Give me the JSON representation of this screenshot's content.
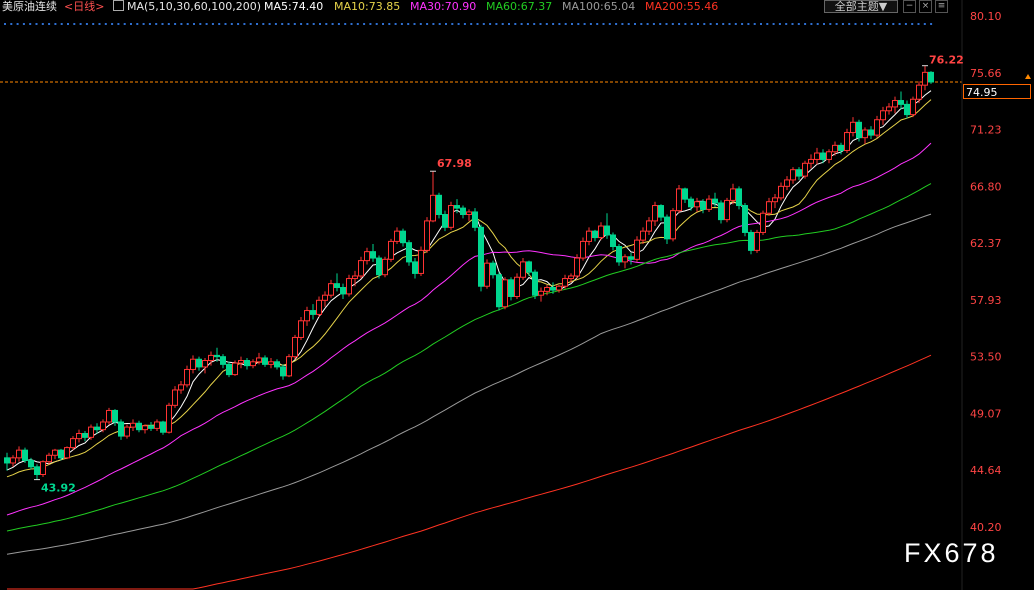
{
  "header": {
    "symbol": "美原油连续",
    "period": "<日线>",
    "ma_label": "MA(5,10,30,60,100,200)",
    "ma5": "MA5:74.40",
    "ma10": "MA10:73.85",
    "ma30": "MA30:70.90",
    "ma60": "MA60:67.37",
    "ma100": "MA100:65.04",
    "ma200": "MA200:55.46",
    "theme_button": "全部主题▼"
  },
  "colors": {
    "up": "#ff3333",
    "down": "#00d68f",
    "ma5": "#ffffff",
    "ma10": "#e6d34a",
    "ma30": "#ff33ff",
    "ma60": "#22cc22",
    "ma100": "#9a9a9a",
    "ma200": "#ff3322",
    "axis_text": "#ff4444",
    "current_price_line": "#ff8800"
  },
  "watermark": "FX678",
  "current_price": "74.95",
  "chart_data": {
    "type": "candlestick",
    "y_ticks": [
      "80.10",
      "75.66",
      "71.23",
      "66.80",
      "62.37",
      "57.93",
      "53.50",
      "49.07",
      "44.64",
      "40.20"
    ],
    "ylim": [
      37.8,
      80.1
    ],
    "grid": false,
    "annotations": {
      "high": "76.22",
      "peak_mid": "67.98",
      "low": "43.92"
    },
    "candles": [
      [
        45.6,
        46.0,
        44.6,
        45.2
      ],
      [
        45.2,
        45.8,
        44.9,
        45.6
      ],
      [
        45.6,
        46.5,
        45.3,
        46.2
      ],
      [
        46.2,
        46.4,
        45.2,
        45.4
      ],
      [
        45.4,
        45.6,
        44.7,
        44.9
      ],
      [
        44.9,
        45.1,
        43.9,
        44.3
      ],
      [
        44.3,
        45.4,
        44.1,
        45.3
      ],
      [
        45.3,
        46.0,
        45.1,
        45.8
      ],
      [
        45.8,
        46.3,
        45.5,
        46.2
      ],
      [
        46.2,
        46.3,
        45.4,
        45.6
      ],
      [
        45.6,
        46.5,
        45.5,
        46.4
      ],
      [
        46.4,
        47.3,
        46.2,
        47.1
      ],
      [
        47.1,
        47.8,
        46.8,
        47.5
      ],
      [
        47.5,
        47.7,
        46.9,
        47.2
      ],
      [
        47.2,
        48.2,
        47.0,
        48.0
      ],
      [
        48.0,
        48.3,
        47.5,
        47.8
      ],
      [
        47.8,
        48.6,
        47.6,
        48.4
      ],
      [
        48.4,
        49.5,
        48.2,
        49.3
      ],
      [
        49.3,
        49.4,
        48.1,
        48.4
      ],
      [
        48.4,
        48.6,
        47.0,
        47.3
      ],
      [
        47.3,
        48.2,
        47.1,
        48.0
      ],
      [
        48.0,
        48.6,
        47.7,
        48.3
      ],
      [
        48.3,
        48.5,
        47.6,
        47.8
      ],
      [
        47.8,
        48.2,
        47.5,
        48.1
      ],
      [
        48.1,
        48.4,
        47.7,
        47.9
      ],
      [
        47.9,
        48.6,
        47.7,
        48.4
      ],
      [
        48.4,
        48.5,
        47.4,
        47.6
      ],
      [
        47.6,
        49.9,
        47.5,
        49.7
      ],
      [
        49.7,
        51.2,
        49.5,
        50.9
      ],
      [
        50.9,
        51.6,
        50.6,
        51.3
      ],
      [
        51.3,
        52.8,
        51.1,
        52.5
      ],
      [
        52.5,
        53.6,
        52.2,
        53.3
      ],
      [
        53.3,
        53.5,
        52.4,
        52.7
      ],
      [
        52.7,
        53.4,
        52.2,
        53.2
      ],
      [
        53.2,
        53.9,
        52.8,
        53.6
      ],
      [
        53.6,
        54.2,
        53.1,
        53.5
      ],
      [
        53.5,
        53.7,
        52.6,
        52.9
      ],
      [
        52.9,
        53.1,
        51.9,
        52.1
      ],
      [
        52.1,
        53.2,
        52.0,
        53.0
      ],
      [
        53.0,
        53.5,
        52.6,
        53.2
      ],
      [
        53.2,
        53.4,
        52.5,
        52.8
      ],
      [
        52.8,
        53.3,
        52.6,
        53.1
      ],
      [
        53.1,
        53.8,
        52.9,
        53.4
      ],
      [
        53.4,
        53.6,
        52.7,
        52.9
      ],
      [
        52.9,
        53.4,
        52.6,
        53.1
      ],
      [
        53.1,
        53.3,
        52.5,
        52.7
      ],
      [
        52.7,
        52.9,
        51.7,
        52.0
      ],
      [
        52.0,
        53.7,
        51.9,
        53.5
      ],
      [
        53.5,
        55.2,
        53.3,
        55.0
      ],
      [
        55.0,
        56.6,
        54.8,
        56.3
      ],
      [
        56.3,
        57.4,
        55.9,
        57.1
      ],
      [
        57.1,
        57.6,
        56.4,
        56.8
      ],
      [
        56.8,
        58.2,
        56.6,
        57.9
      ],
      [
        57.9,
        58.6,
        57.4,
        58.3
      ],
      [
        58.3,
        59.5,
        58.1,
        59.2
      ],
      [
        59.2,
        60.0,
        58.6,
        58.9
      ],
      [
        58.9,
        59.2,
        58.0,
        58.4
      ],
      [
        58.4,
        59.9,
        58.2,
        59.6
      ],
      [
        59.6,
        60.2,
        59.0,
        59.8
      ],
      [
        59.8,
        61.3,
        59.6,
        61.0
      ],
      [
        61.0,
        62.0,
        60.7,
        61.7
      ],
      [
        61.7,
        62.3,
        60.9,
        61.2
      ],
      [
        61.2,
        61.4,
        59.6,
        59.9
      ],
      [
        59.9,
        61.3,
        59.7,
        61.1
      ],
      [
        61.1,
        62.7,
        60.9,
        62.5
      ],
      [
        62.5,
        63.6,
        62.3,
        63.3
      ],
      [
        63.3,
        63.5,
        62.1,
        62.4
      ],
      [
        62.4,
        62.6,
        60.6,
        60.9
      ],
      [
        60.9,
        61.2,
        59.6,
        60.0
      ],
      [
        60.0,
        62.1,
        59.8,
        61.8
      ],
      [
        61.8,
        64.4,
        61.6,
        64.1
      ],
      [
        64.1,
        67.98,
        64.0,
        66.1
      ],
      [
        66.1,
        66.3,
        64.3,
        64.6
      ],
      [
        64.6,
        64.9,
        63.3,
        63.6
      ],
      [
        63.6,
        65.6,
        63.4,
        65.3
      ],
      [
        65.3,
        65.8,
        64.7,
        65.1
      ],
      [
        65.1,
        65.3,
        64.3,
        64.6
      ],
      [
        64.6,
        65.0,
        64.1,
        64.8
      ],
      [
        64.8,
        65.1,
        63.3,
        63.6
      ],
      [
        63.6,
        63.8,
        58.6,
        59.0
      ],
      [
        59.0,
        61.1,
        58.8,
        60.8
      ],
      [
        60.8,
        61.0,
        59.6,
        59.9
      ],
      [
        59.9,
        60.1,
        57.1,
        57.4
      ],
      [
        57.4,
        59.7,
        57.2,
        59.5
      ],
      [
        59.5,
        59.7,
        57.9,
        58.2
      ],
      [
        58.2,
        60.0,
        58.0,
        59.7
      ],
      [
        59.7,
        61.2,
        59.5,
        60.9
      ],
      [
        60.9,
        61.0,
        59.8,
        60.1
      ],
      [
        60.1,
        60.3,
        58.0,
        58.3
      ],
      [
        58.3,
        58.9,
        57.8,
        58.6
      ],
      [
        58.6,
        59.1,
        58.3,
        58.9
      ],
      [
        58.9,
        59.3,
        58.4,
        58.7
      ],
      [
        58.7,
        59.1,
        58.5,
        59.0
      ],
      [
        59.0,
        59.9,
        58.8,
        59.6
      ],
      [
        59.6,
        60.0,
        59.3,
        59.8
      ],
      [
        59.8,
        61.5,
        59.6,
        61.2
      ],
      [
        61.2,
        62.8,
        61.0,
        62.5
      ],
      [
        62.5,
        63.6,
        62.2,
        63.3
      ],
      [
        63.3,
        63.4,
        62.5,
        62.8
      ],
      [
        62.8,
        64.0,
        62.6,
        63.7
      ],
      [
        63.7,
        64.7,
        62.7,
        63.0
      ],
      [
        63.0,
        63.2,
        61.8,
        62.1
      ],
      [
        62.1,
        62.3,
        60.6,
        60.9
      ],
      [
        60.9,
        61.5,
        60.4,
        61.3
      ],
      [
        61.3,
        61.6,
        60.7,
        61.1
      ],
      [
        61.1,
        62.9,
        60.9,
        62.6
      ],
      [
        62.6,
        63.6,
        62.3,
        63.3
      ],
      [
        63.3,
        64.4,
        63.0,
        64.1
      ],
      [
        64.1,
        65.6,
        63.7,
        65.3
      ],
      [
        65.3,
        65.4,
        64.1,
        64.4
      ],
      [
        64.4,
        64.6,
        62.3,
        62.7
      ],
      [
        62.7,
        65.1,
        62.5,
        64.9
      ],
      [
        64.9,
        66.9,
        64.7,
        66.6
      ],
      [
        66.6,
        66.7,
        65.5,
        65.8
      ],
      [
        65.8,
        66.0,
        64.9,
        65.2
      ],
      [
        65.2,
        65.9,
        64.8,
        65.6
      ],
      [
        65.6,
        65.8,
        64.7,
        65.0
      ],
      [
        65.0,
        66.1,
        64.8,
        65.8
      ],
      [
        65.8,
        66.3,
        65.2,
        65.5
      ],
      [
        65.5,
        65.7,
        63.9,
        64.2
      ],
      [
        64.2,
        65.9,
        64.0,
        65.7
      ],
      [
        65.7,
        67.0,
        65.4,
        66.6
      ],
      [
        66.6,
        66.8,
        65.0,
        65.3
      ],
      [
        65.3,
        65.5,
        62.9,
        63.2
      ],
      [
        63.2,
        63.4,
        61.5,
        61.8
      ],
      [
        61.8,
        63.4,
        61.6,
        63.2
      ],
      [
        63.2,
        64.9,
        63.0,
        64.7
      ],
      [
        64.7,
        65.9,
        64.5,
        65.6
      ],
      [
        65.6,
        66.2,
        65.1,
        65.9
      ],
      [
        65.9,
        67.1,
        65.7,
        66.8
      ],
      [
        66.8,
        67.6,
        66.5,
        67.3
      ],
      [
        67.3,
        68.3,
        67.0,
        68.1
      ],
      [
        68.1,
        68.3,
        67.3,
        67.6
      ],
      [
        67.6,
        68.8,
        67.4,
        68.6
      ],
      [
        68.6,
        69.3,
        68.2,
        68.9
      ],
      [
        68.9,
        69.8,
        68.5,
        69.4
      ],
      [
        69.4,
        69.7,
        68.6,
        68.9
      ],
      [
        68.9,
        69.7,
        68.6,
        69.5
      ],
      [
        69.5,
        70.3,
        69.2,
        70.0
      ],
      [
        70.0,
        70.2,
        69.3,
        69.6
      ],
      [
        69.6,
        71.3,
        69.4,
        71.0
      ],
      [
        71.0,
        72.2,
        70.7,
        71.8
      ],
      [
        71.8,
        72.0,
        70.3,
        70.6
      ],
      [
        70.6,
        71.4,
        70.1,
        71.2
      ],
      [
        71.2,
        71.5,
        70.5,
        70.8
      ],
      [
        70.8,
        72.3,
        70.6,
        72.0
      ],
      [
        72.0,
        73.0,
        71.6,
        72.7
      ],
      [
        72.7,
        73.3,
        72.4,
        73.0
      ],
      [
        73.0,
        73.8,
        72.5,
        73.5
      ],
      [
        73.5,
        74.2,
        72.8,
        73.2
      ],
      [
        73.2,
        73.5,
        72.1,
        72.4
      ],
      [
        72.4,
        73.8,
        72.2,
        73.6
      ],
      [
        73.6,
        75.0,
        73.3,
        74.7
      ],
      [
        74.7,
        76.22,
        74.3,
        75.7
      ],
      [
        75.7,
        75.8,
        74.8,
        74.95
      ]
    ]
  }
}
